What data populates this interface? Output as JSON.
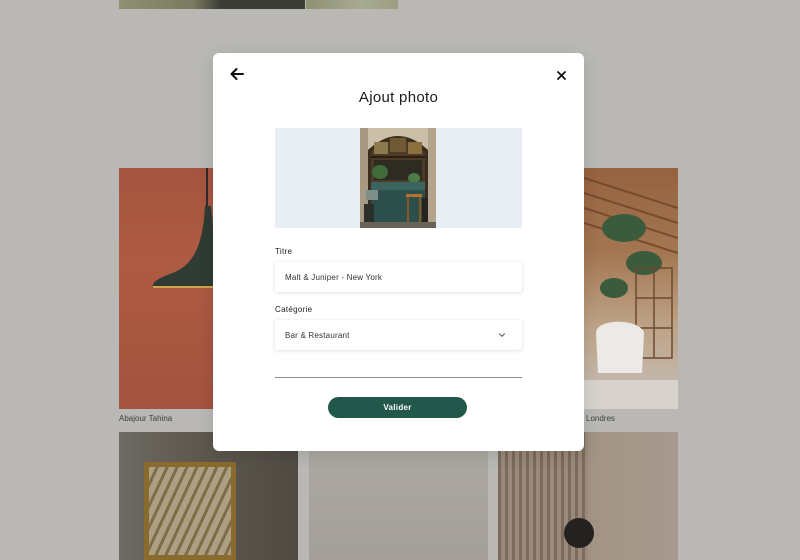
{
  "gallery": {
    "captions": {
      "lamp": "Abajour Tahina",
      "london": "Londres"
    }
  },
  "modal": {
    "title": "Ajout photo",
    "back_icon": "arrow-left-icon",
    "close_icon": "close-icon",
    "title_field": {
      "label": "Titre",
      "value": "Malt & Juniper - New York"
    },
    "category_field": {
      "label": "Catégorie",
      "selected": "Bar & Restaurant",
      "icon": "chevron-down-icon"
    },
    "submit_label": "Valider"
  },
  "colors": {
    "overlay": "#b9b8b4",
    "accent": "#22574b",
    "photo_background": "#e9eef4"
  }
}
